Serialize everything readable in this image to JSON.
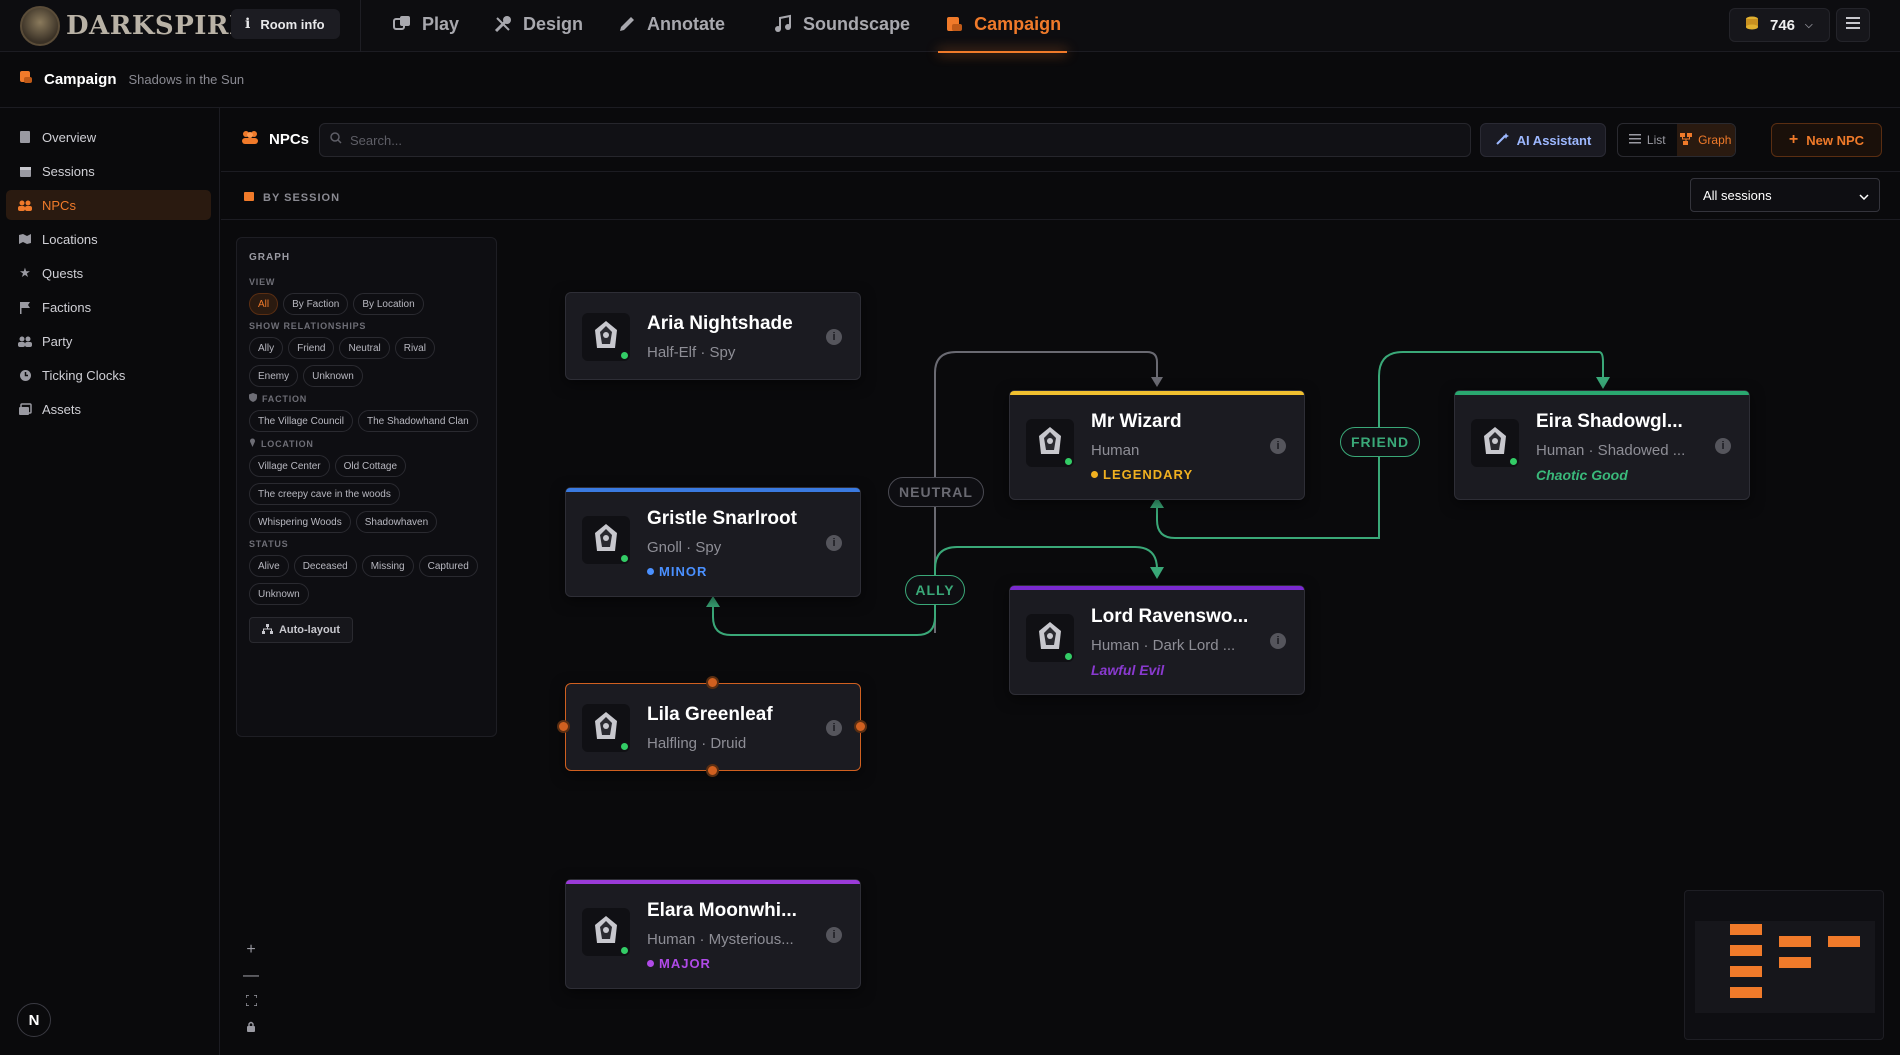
{
  "app": {
    "name": "DARKSPIRE"
  },
  "topbar": {
    "room_info": "Room info",
    "nav": [
      {
        "label": "Play",
        "icon": "dice-icon"
      },
      {
        "label": "Design",
        "icon": "tools-icon"
      },
      {
        "label": "Annotate",
        "icon": "pencil-icon"
      },
      {
        "label": "Soundscape",
        "icon": "music-icon"
      },
      {
        "label": "Campaign",
        "icon": "scroll-icon",
        "active": true
      }
    ],
    "coins": "746"
  },
  "subheader": {
    "title": "Campaign",
    "subtitle": "Shadows in the Sun"
  },
  "sidebar": {
    "items": [
      {
        "label": "Overview",
        "icon": "book-icon"
      },
      {
        "label": "Sessions",
        "icon": "calendar-icon"
      },
      {
        "label": "NPCs",
        "icon": "users-icon",
        "active": true
      },
      {
        "label": "Locations",
        "icon": "map-icon"
      },
      {
        "label": "Quests",
        "icon": "star-icon"
      },
      {
        "label": "Factions",
        "icon": "flag-icon"
      },
      {
        "label": "Party",
        "icon": "party-icon"
      },
      {
        "label": "Ticking Clocks",
        "icon": "clock-icon"
      },
      {
        "label": "Assets",
        "icon": "images-icon"
      }
    ],
    "user_initial": "N"
  },
  "toolbar": {
    "title": "NPCs",
    "search_placeholder": "Search...",
    "ai_label": "AI Assistant",
    "list_label": "List",
    "graph_label": "Graph",
    "new_label": "New NPC"
  },
  "filterbar": {
    "by_session": "BY SESSION",
    "session_value": "All sessions"
  },
  "graph_panel": {
    "title": "GRAPH",
    "view_label": "VIEW",
    "views": [
      "All",
      "By Faction",
      "By Location"
    ],
    "relationships_label": "SHOW RELATIONSHIPS",
    "relationships": [
      "Ally",
      "Friend",
      "Neutral",
      "Rival",
      "Enemy",
      "Unknown"
    ],
    "faction_label": "FACTION",
    "factions": [
      "The Village Council",
      "The Shadowhand Clan"
    ],
    "location_label": "LOCATION",
    "locations": [
      "Village Center",
      "Old Cottage",
      "The creepy cave in the woods",
      "Whispering Woods",
      "Shadowhaven"
    ],
    "status_label": "STATUS",
    "statuses": [
      "Alive",
      "Deceased",
      "Missing",
      "Captured",
      "Unknown"
    ],
    "auto_layout": "Auto-layout"
  },
  "nodes": {
    "aria": {
      "name": "Aria Nightshade",
      "meta": "Half-Elf · Spy"
    },
    "gristle": {
      "name": "Gristle Snarlroot",
      "meta": "Gnoll · Spy",
      "tag": "MINOR",
      "tag_color": "#4a90ff",
      "bar_color": "#3a7ae0"
    },
    "lila": {
      "name": "Lila Greenleaf",
      "meta": "Halfling · Druid"
    },
    "elara": {
      "name": "Elara Moonwhi...",
      "meta": "Human · Mysterious...",
      "tag": "MAJOR",
      "tag_color": "#b04ae8",
      "bar_color": "#9a3ad8"
    },
    "wizard": {
      "name": "Mr Wizard",
      "meta": "Human",
      "tag": "LEGENDARY",
      "tag_color": "#f0b020",
      "bar_color": "#f0c030"
    },
    "lord": {
      "name": "Lord Ravenswo...",
      "meta": "Human · Dark Lord ...",
      "alignment": "Lawful Evil",
      "alignment_color": "#8a3ad0",
      "bar_color": "#7a2ad0"
    },
    "eira": {
      "name": "Eira Shadowgl...",
      "meta": "Human · Shadowed ...",
      "alignment": "Chaotic Good",
      "alignment_color": "#3ab87a",
      "bar_color": "#2aa870"
    }
  },
  "edge_labels": {
    "neutral": "NEUTRAL",
    "ally": "ALLY",
    "friend": "FRIEND"
  },
  "colors": {
    "accent": "#f07a2a",
    "ally": "#3aa878",
    "neutral": "#6a6a72"
  }
}
